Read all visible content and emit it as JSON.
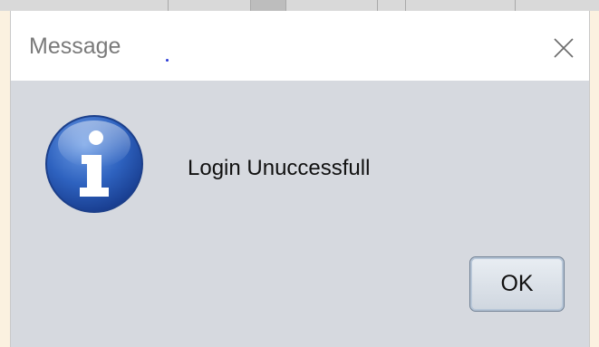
{
  "dialog": {
    "title": "Message",
    "message": "Login Unuccessfull",
    "ok_label": "OK",
    "icon": "info-icon",
    "close_icon": "close-icon"
  },
  "colors": {
    "titlebar_bg": "#ffffff",
    "body_bg": "#d6d9df",
    "icon_blue": "#2f5fb3",
    "title_text": "#7a7a7a"
  }
}
